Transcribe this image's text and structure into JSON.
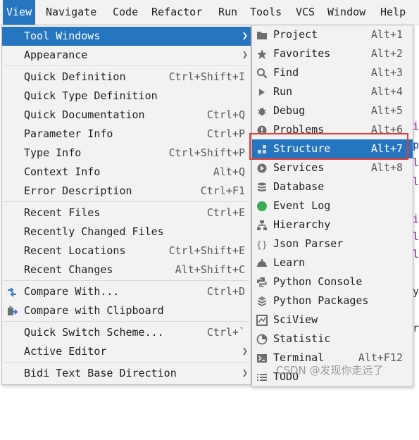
{
  "menubar": {
    "items": [
      "View",
      "Navigate",
      "Code",
      "Refactor",
      "Run",
      "Tools",
      "VCS",
      "Window",
      "Help"
    ]
  },
  "background": {
    "fragments": [
      "i",
      "p",
      "l",
      "l",
      "i",
      "l",
      "l",
      "y",
      "r"
    ]
  },
  "view_menu": {
    "items": [
      {
        "label": "Tool Windows",
        "shortcut": "",
        "submenu": true,
        "selected": true
      },
      {
        "label": "Appearance",
        "shortcut": "",
        "submenu": true
      },
      {
        "label": "Quick Definition",
        "shortcut": "Ctrl+Shift+I"
      },
      {
        "label": "Quick Type Definition",
        "shortcut": ""
      },
      {
        "label": "Quick Documentation",
        "shortcut": "Ctrl+Q"
      },
      {
        "label": "Parameter Info",
        "shortcut": "Ctrl+P"
      },
      {
        "label": "Type Info",
        "shortcut": "Ctrl+Shift+P"
      },
      {
        "label": "Context Info",
        "shortcut": "Alt+Q"
      },
      {
        "label": "Error Description",
        "shortcut": "Ctrl+F1"
      },
      {
        "label": "Recent Files",
        "shortcut": "Ctrl+E"
      },
      {
        "label": "Recently Changed Files",
        "shortcut": ""
      },
      {
        "label": "Recent Locations",
        "shortcut": "Ctrl+Shift+E"
      },
      {
        "label": "Recent Changes",
        "shortcut": "Alt+Shift+C"
      },
      {
        "label": "Compare With...",
        "shortcut": "Ctrl+D",
        "icon": "compare-icon"
      },
      {
        "label": "Compare with Clipboard",
        "shortcut": "",
        "icon": "clipboard-compare-icon"
      },
      {
        "label": "Quick Switch Scheme...",
        "shortcut": "Ctrl+`"
      },
      {
        "label": "Active Editor",
        "shortcut": "",
        "submenu": true
      },
      {
        "label": "Bidi Text Base Direction",
        "shortcut": "",
        "submenu": true
      }
    ]
  },
  "tool_windows_menu": {
    "items": [
      {
        "label": "Project",
        "shortcut": "Alt+1",
        "icon": "folder-icon"
      },
      {
        "label": "Favorites",
        "shortcut": "Alt+2",
        "icon": "star-icon"
      },
      {
        "label": "Find",
        "shortcut": "Alt+3",
        "icon": "search-icon"
      },
      {
        "label": "Run",
        "shortcut": "Alt+4",
        "icon": "play-icon"
      },
      {
        "label": "Debug",
        "shortcut": "Alt+5",
        "icon": "bug-icon"
      },
      {
        "label": "Problems",
        "shortcut": "Alt+6",
        "icon": "warning-icon"
      },
      {
        "label": "Structure",
        "shortcut": "Alt+7",
        "icon": "structure-icon",
        "selected": true
      },
      {
        "label": "Services",
        "shortcut": "Alt+8",
        "icon": "services-icon"
      },
      {
        "label": "Database",
        "shortcut": "",
        "icon": "database-icon"
      },
      {
        "label": "Event Log",
        "shortcut": "",
        "icon": "event-log-icon"
      },
      {
        "label": "Hierarchy",
        "shortcut": "",
        "icon": "hierarchy-icon"
      },
      {
        "label": "Json Parser",
        "shortcut": "",
        "icon": "braces-icon"
      },
      {
        "label": "Learn",
        "shortcut": "",
        "icon": "learn-icon"
      },
      {
        "label": "Python Console",
        "shortcut": "",
        "icon": "python-icon"
      },
      {
        "label": "Python Packages",
        "shortcut": "",
        "icon": "packages-icon"
      },
      {
        "label": "SciView",
        "shortcut": "",
        "icon": "sciview-icon"
      },
      {
        "label": "Statistic",
        "shortcut": "",
        "icon": "statistic-icon"
      },
      {
        "label": "Terminal",
        "shortcut": "Alt+F12",
        "icon": "terminal-icon"
      },
      {
        "label": "TODO",
        "shortcut": "",
        "icon": "todo-icon"
      }
    ]
  },
  "watermark": "CSDN @发现你走远了",
  "colors": {
    "selection": "#2675bf",
    "menu_bg": "#f2f2f2",
    "highlight_box": "#e53c35"
  }
}
